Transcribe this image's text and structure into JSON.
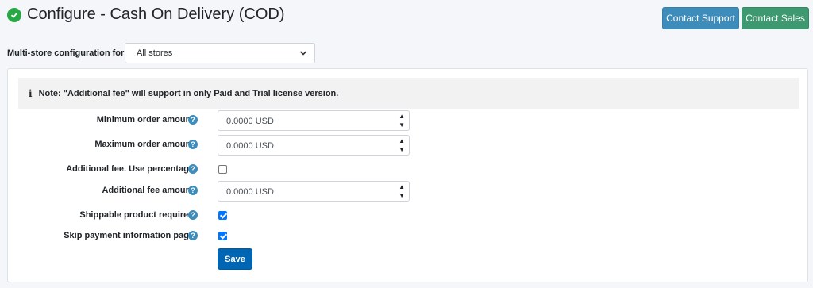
{
  "header": {
    "title": "Configure - Cash On Delivery (COD)",
    "contact_support": "Contact Support",
    "contact_sales": "Contact Sales"
  },
  "store": {
    "label": "Multi-store configuration for",
    "selected": "All stores"
  },
  "note": {
    "text": "Note: \"Additional fee\" will support in only Paid and Trial license version."
  },
  "fields": {
    "min_order": {
      "label": "Minimum order amount",
      "value": "0.0000 USD"
    },
    "max_order": {
      "label": "Maximum order amount",
      "value": "0.0000 USD"
    },
    "fee_percentage": {
      "label": "Additional fee. Use percentage",
      "checked": false
    },
    "fee_amount": {
      "label": "Additional fee amount",
      "value": "0.0000 USD"
    },
    "shippable": {
      "label": "Shippable product required",
      "checked": true
    },
    "skip_payment": {
      "label": "Skip payment information page",
      "checked": true
    }
  },
  "save_label": "Save",
  "colors": {
    "success": "#28a745",
    "support_button": "#3c8dbc",
    "sales_button": "#3d9970",
    "save_button": "#0066b3"
  },
  "icons": {
    "title": "check-circle-icon",
    "note": "info-icon",
    "help": "question-circle-icon",
    "select": "chevron-down-icon"
  }
}
